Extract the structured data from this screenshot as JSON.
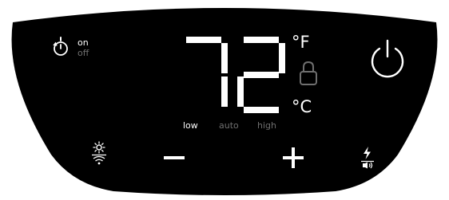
{
  "panel": {
    "colors": {
      "panel": "#000000",
      "background": "#ffffff",
      "foreground": "#ffffff",
      "inactive": "#6f6f6f"
    }
  },
  "timer": {
    "icon": "timer-icon",
    "on_label": "on",
    "off_label": "off",
    "state": "on"
  },
  "display": {
    "temperature": "72",
    "unit_f_label": "°F",
    "unit_c_label": "°C",
    "active_unit": "F",
    "lock_icon": "lock-icon"
  },
  "power": {
    "icon": "power-icon"
  },
  "fan_speed": {
    "options": [
      "low",
      "auto",
      "high"
    ],
    "selected": "low"
  },
  "controls": {
    "mode_icon": "sun-wifi-icon",
    "decrease_icon": "minus-icon",
    "increase_icon": "plus-icon",
    "boost_icon": "bolt-speaker-icon"
  }
}
